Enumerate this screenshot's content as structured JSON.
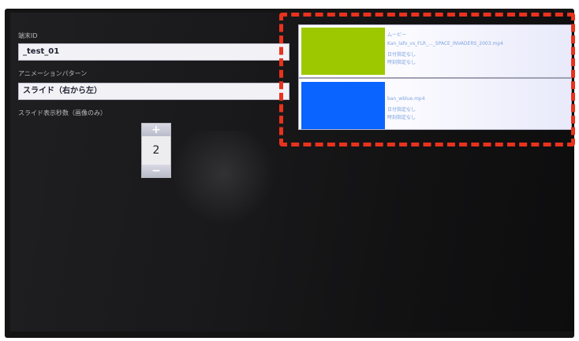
{
  "settings": {
    "terminal_id_label": "端末ID",
    "terminal_id_value": "_test_01",
    "animation_label": "アニメーションパターン",
    "animation_value": "スライド（右から左）",
    "slide_seconds_label": "スライド表示秒数（画像のみ）",
    "stepper": {
      "plus": "+",
      "value": "2",
      "minus": "−"
    }
  },
  "media_list": {
    "items": [
      {
        "title": "ムービー",
        "filename": "Kan_lafo_vs_FLR_..._SPACE_INVADERS_2003.mp4",
        "line1": "日付指定なし",
        "line2": "時刻指定なし",
        "thumb_color": "#9dc800",
        "thumb_icon": "video-thumbnail"
      },
      {
        "title": "",
        "filename": "ban_wblue.mp4",
        "line1": "日付指定なし",
        "line2": "時刻指定なし",
        "thumb_color": "#0a64ff",
        "thumb_icon": "image-thumbnail"
      }
    ]
  },
  "colors": {
    "highlight_dash": "#e8321d",
    "screen_bg": "#1a1a1c"
  }
}
